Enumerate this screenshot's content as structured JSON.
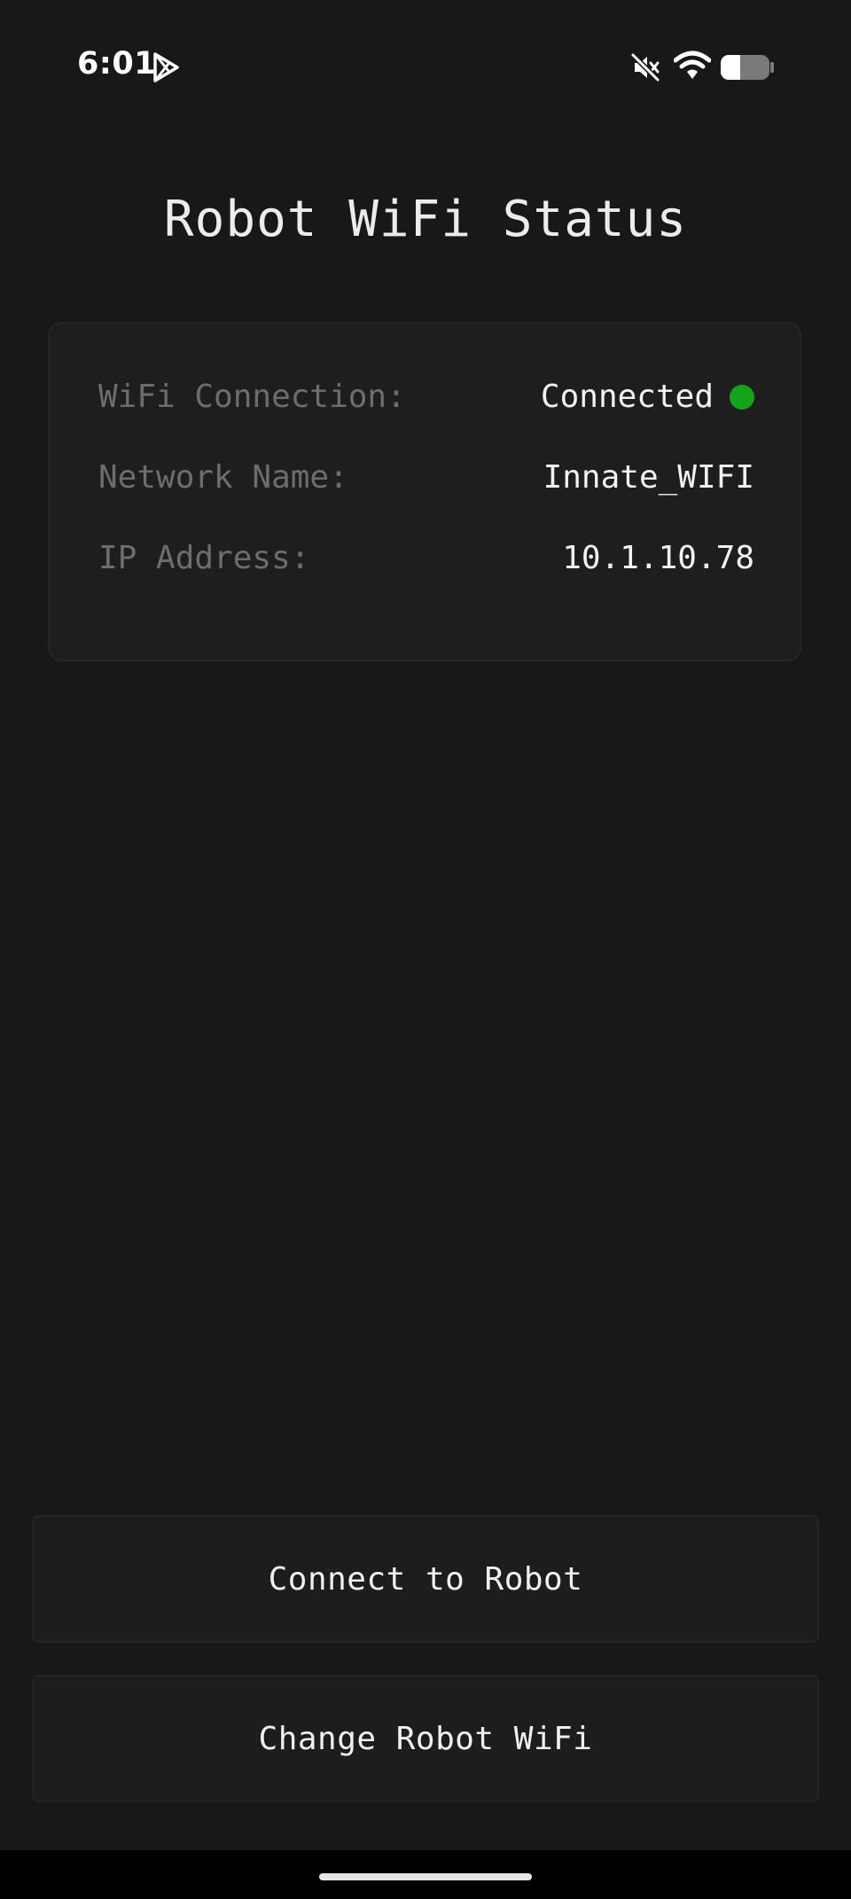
{
  "status_bar": {
    "time": "6:01",
    "icons": [
      "play-store-icon",
      "mute-icon",
      "wifi-icon",
      "battery-icon"
    ],
    "battery_level": 0.35
  },
  "page": {
    "title": "Robot WiFi Status"
  },
  "wifi_card": {
    "rows": [
      {
        "label": "WiFi Connection:",
        "value": "Connected",
        "indicator_color": "#13a41a"
      },
      {
        "label": "Network Name:",
        "value": "Innate_WIFI"
      },
      {
        "label": "IP Address:",
        "value": "10.1.10.78"
      }
    ]
  },
  "actions": {
    "connect_label": "Connect to Robot",
    "change_wifi_label": "Change Robot WiFi"
  },
  "colors": {
    "background": "#181818",
    "card": "#1e1e1e",
    "connected": "#13a41a"
  }
}
